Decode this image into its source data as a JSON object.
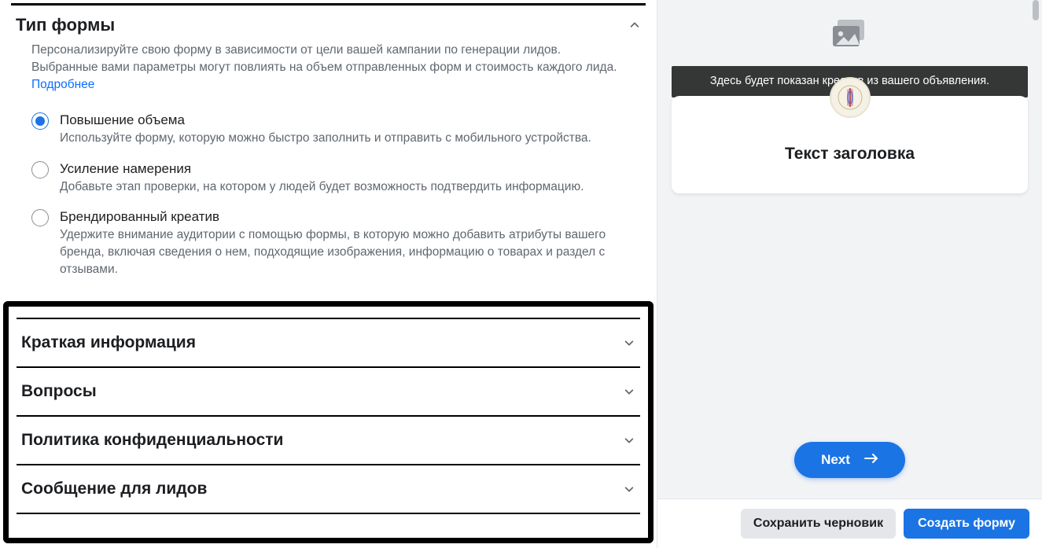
{
  "formType": {
    "title": "Тип формы",
    "description_a": "Персонализируйте свою форму в зависимости от цели вашей кампании по генерации лидов. Выбранные вами параметры могут повлиять на объем отправленных форм и стоимость каждого лида. ",
    "learn_more": "Подробнее",
    "options": [
      {
        "label": "Повышение объема",
        "sub": "Используйте форму, которую можно быстро заполнить и отправить с мобильного устройства.",
        "selected": true
      },
      {
        "label": "Усиление намерения",
        "sub": "Добавьте этап проверки, на котором у людей будет возможность подтвердить информацию.",
        "selected": false
      },
      {
        "label": "Брендированный креатив",
        "sub": "Удержите внимание аудитории с помощью формы, в которую можно добавить атрибуты вашего бренда, включая сведения о нем, подходящие изображения, информацию о товарах и раздел с отзывами.",
        "selected": false
      }
    ]
  },
  "sections": [
    {
      "title": "Краткая информация"
    },
    {
      "title": "Вопросы"
    },
    {
      "title": "Политика конфиденциальности"
    },
    {
      "title": "Сообщение для лидов"
    }
  ],
  "preview": {
    "creative_notice": "Здесь будет показан креатив из вашего объявления.",
    "headline": "Текст заголовка",
    "next": "Next"
  },
  "footer": {
    "save_draft": "Сохранить черновик",
    "create_form": "Создать форму"
  }
}
